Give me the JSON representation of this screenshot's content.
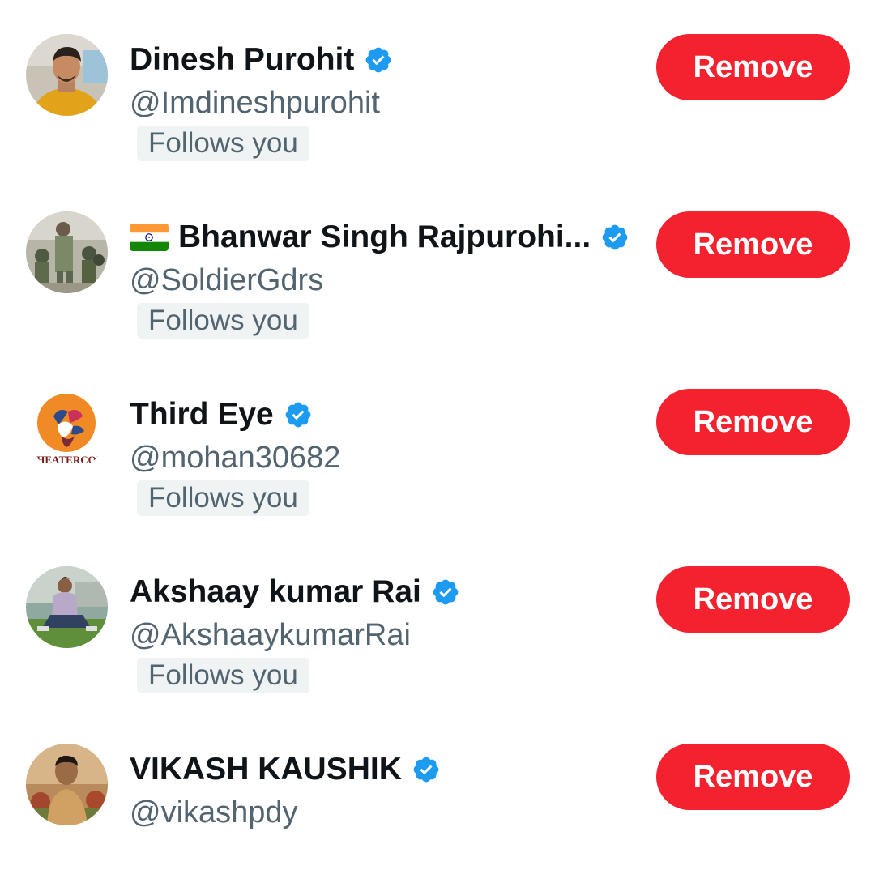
{
  "followers": [
    {
      "name": "Dinesh Purohit",
      "handle": "@Imdineshpurohit",
      "follows_label": "Follows you",
      "verified": true,
      "flag": "",
      "button_label": "Remove",
      "avatar": "person-yellow-shirt-avatar"
    },
    {
      "name": "Bhanwar Singh Rajpurohi...",
      "handle": "@SoldierGdrs",
      "follows_label": "Follows you",
      "verified": true,
      "flag": "india-flag-emoji",
      "button_label": "Remove",
      "avatar": "soldiers-group-avatar"
    },
    {
      "name": "Third Eye",
      "handle": "@mohan30682",
      "follows_label": "Follows you",
      "verified": true,
      "flag": "",
      "button_label": "Remove",
      "avatar": "bird-logo-avatar",
      "avatar_text": "'HEATERCO'"
    },
    {
      "name": "Akshaay kumar Rai",
      "handle": "@AkshaaykumarRai",
      "follows_label": "Follows you",
      "verified": true,
      "flag": "",
      "button_label": "Remove",
      "avatar": "person-sitting-grass-avatar"
    },
    {
      "name": "VIKASH KAUSHIK",
      "handle": "@vikashpdy",
      "follows_label": "",
      "verified": true,
      "flag": "",
      "button_label": "Remove",
      "avatar": "person-outdoor-avatar"
    }
  ],
  "colors": {
    "remove_button": "#f4212e",
    "verified_badge": "#1d9bf0",
    "name_text": "#0f1419",
    "secondary_text": "#536471",
    "follows_pill_bg": "#eff3f4"
  }
}
